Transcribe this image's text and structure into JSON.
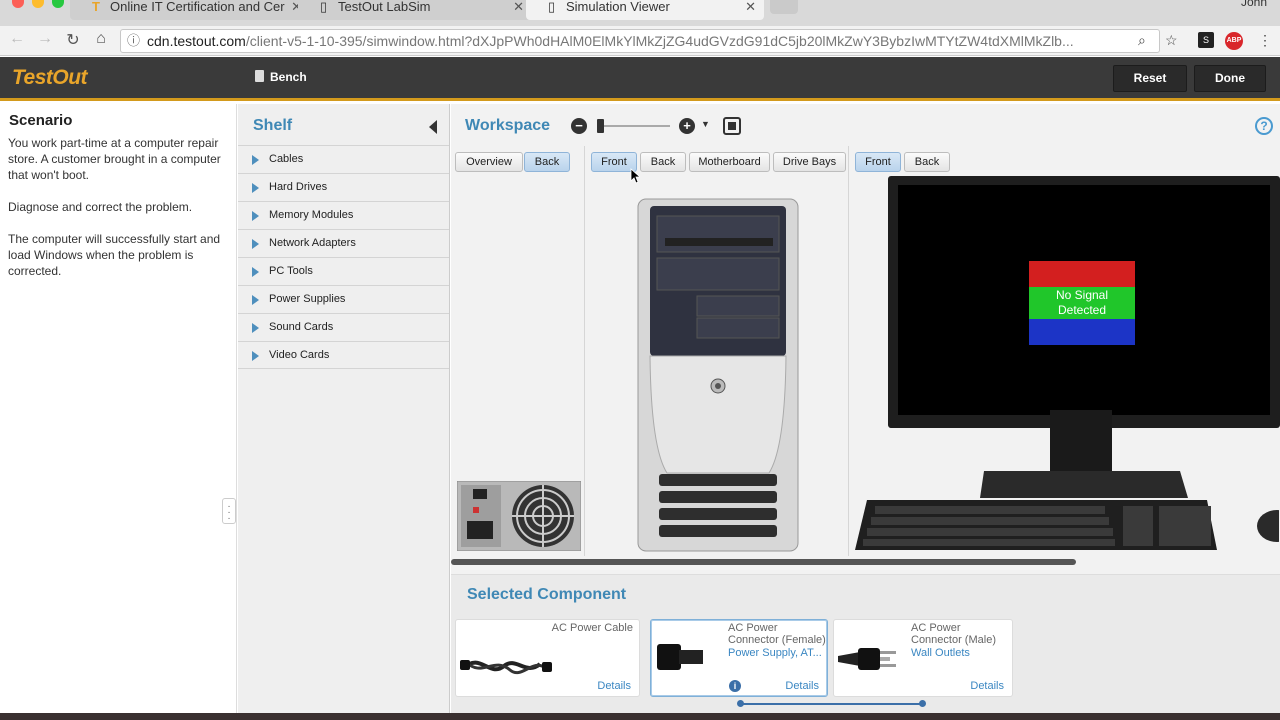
{
  "browser": {
    "tabs": [
      {
        "title": "Online IT Certification and Cer",
        "favicon": "testout-logo-icon"
      },
      {
        "title": "TestOut LabSim",
        "favicon": "page-icon"
      },
      {
        "title": "Simulation Viewer",
        "favicon": "page-icon"
      }
    ],
    "profile_name": "John",
    "url_host": "cdn.testout.com",
    "url_path": "/client-v5-1-10-395/simwindow.html?dXJpPWh0dHAlM0ElMkYlMkZjZG4udGVzdG91dC5jb20lMkZwY3BybzIwMTYtZW4tdXMlMkZlb..."
  },
  "appbar": {
    "logo": "TestOut",
    "bench_label": "Bench",
    "reset_label": "Reset",
    "done_label": "Done",
    "accent_color": "#d39a1c"
  },
  "scenario": {
    "title": "Scenario",
    "paragraphs": [
      "You work part-time at a computer repair store. A customer brought in a computer that won't boot.",
      "Diagnose and correct the problem.",
      "The computer will successfully start and load Windows when the problem is corrected."
    ]
  },
  "shelf": {
    "title": "Shelf",
    "items": [
      "Cables",
      "Hard Drives",
      "Memory Modules",
      "Network Adapters",
      "PC Tools",
      "Power Supplies",
      "Sound Cards",
      "Video Cards"
    ]
  },
  "workspace": {
    "title": "Workspace",
    "psu_buttons": [
      "Overview",
      "Back"
    ],
    "tower_buttons": [
      "Front",
      "Back",
      "Motherboard",
      "Drive Bays"
    ],
    "monitor_buttons": [
      "Front",
      "Back"
    ],
    "monitor_message_line1": "No Signal",
    "monitor_message_line2": "Detected"
  },
  "selected_component": {
    "title": "Selected Component",
    "cards": [
      {
        "name": "AC Power Cable",
        "sub": "",
        "details": "Details"
      },
      {
        "name_line1": "AC Power",
        "name_line2": "Connector (Female)",
        "sub": "Power Supply, AT...",
        "details": "Details"
      },
      {
        "name_line1": "AC Power",
        "name_line2": "Connector (Male)",
        "sub": "Wall Outlets",
        "details": "Details"
      }
    ]
  }
}
